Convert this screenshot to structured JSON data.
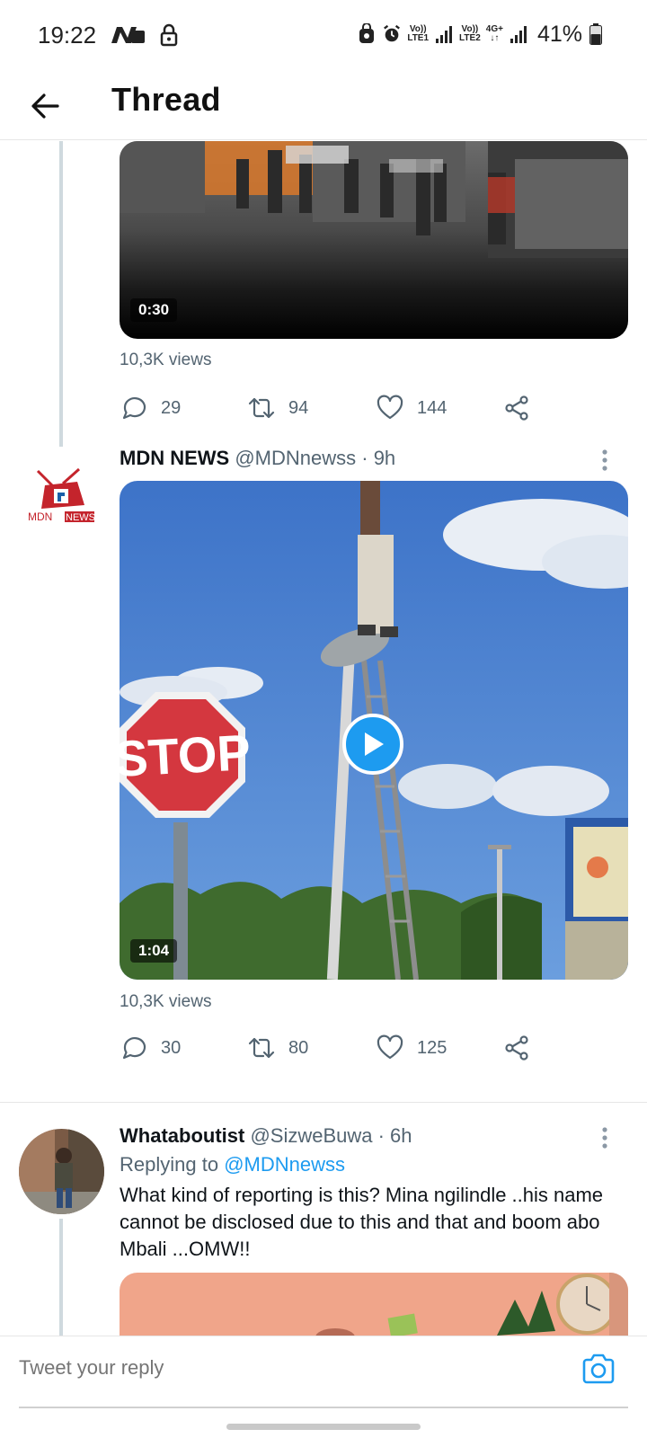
{
  "status_bar": {
    "time": "19:22",
    "battery_percent": "41%",
    "sim1_label_top": "Vo))",
    "sim1_label_bottom": "LTE1",
    "sim2_label_top": "Vo))",
    "sim2_label_bottom": "LTE2",
    "network_type": "4G+"
  },
  "header": {
    "title": "Thread"
  },
  "tweet_prev": {
    "video_duration": "0:30",
    "views": "10,3K views",
    "replies": "29",
    "retweets": "94",
    "likes": "144"
  },
  "tweet_main": {
    "author_name": "MDN NEWS",
    "handle_time": "@MDNnewss · 9h",
    "avatar_text_left": "MDN",
    "avatar_text_right": "NEWS",
    "video_duration": "1:04",
    "sign_text": "STOP",
    "views": "10,3K views",
    "replies": "30",
    "retweets": "80",
    "likes": "125"
  },
  "tweet_reply": {
    "author_name": "Whataboutist",
    "handle_time": "@SizweBuwa · 6h",
    "replying_label": "Replying to",
    "replying_mention": "@MDNnewss",
    "text": "What kind of reporting is this? Mina ngilindle ..his name cannot be disclosed due to this and that and boom abo Mbali ...OMW!!"
  },
  "reply_bar": {
    "placeholder": "Tweet your reply"
  },
  "colors": {
    "accent": "#1d9bf0",
    "muted_text": "#536471",
    "thread_line": "#cfd9de"
  }
}
